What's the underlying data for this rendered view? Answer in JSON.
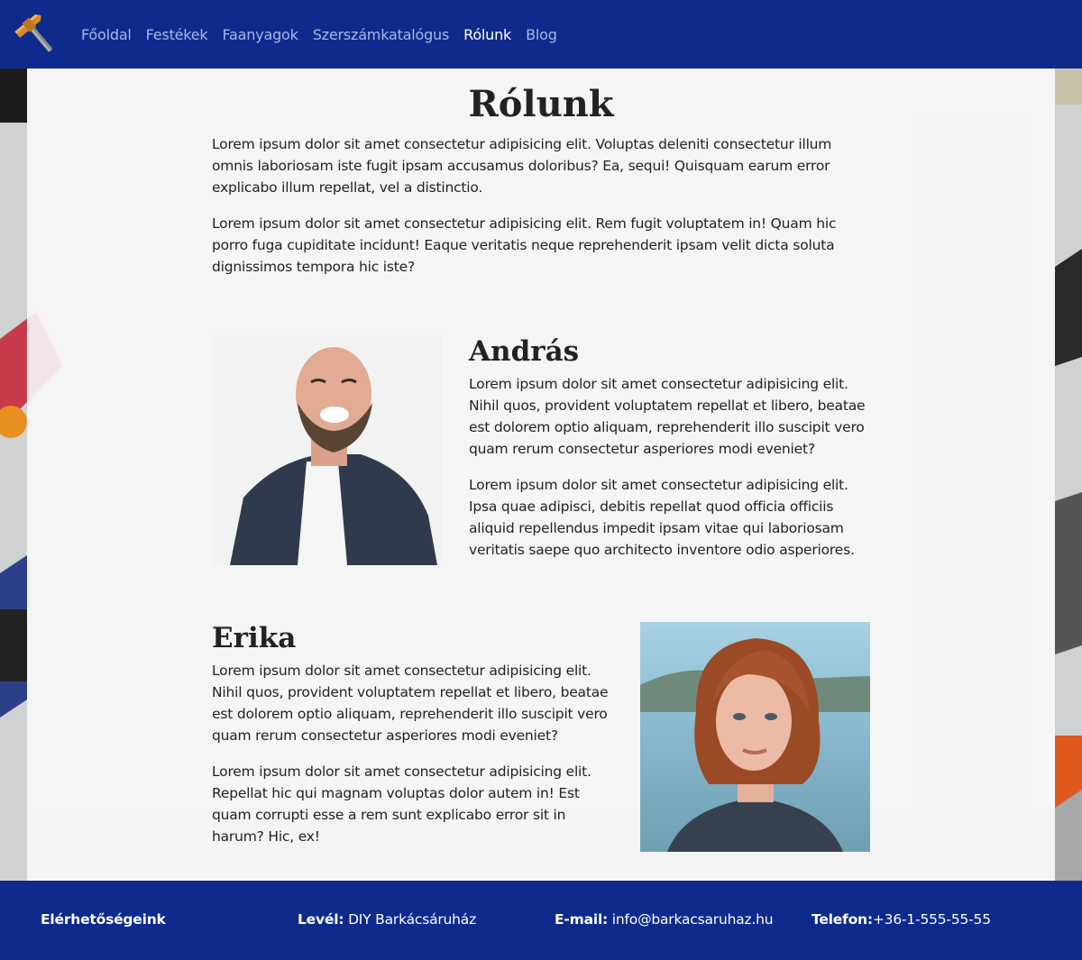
{
  "nav": {
    "logo_icon": "hammer-icon",
    "items": [
      {
        "label": "Főoldal",
        "active": false
      },
      {
        "label": "Festékek",
        "active": false
      },
      {
        "label": "Faanyagok",
        "active": false
      },
      {
        "label": "Szerszámkatalógus",
        "active": false
      },
      {
        "label": "Rólunk",
        "active": true
      },
      {
        "label": "Blog",
        "active": false
      }
    ]
  },
  "colors": {
    "brand": "#0d2a8c",
    "nav_link": "#a9b7e6",
    "nav_active": "#ffffff"
  },
  "page": {
    "title": "Rólunk",
    "intro": [
      "Lorem ipsum dolor sit amet consectetur adipisicing elit. Voluptas deleniti consectetur illum omnis laboriosam iste fugit ipsam accusamus doloribus? Ea, sequi! Quisquam earum error explicabo illum repellat, vel a distinctio.",
      "Lorem ipsum dolor sit amet consectetur adipisicing elit. Rem fugit voluptatem in! Quam hic porro fuga cupiditate incidunt! Eaque veritatis neque reprehenderit ipsam velit dicta soluta dignissimos tempora hic iste?"
    ]
  },
  "people": {
    "andras": {
      "name": "András",
      "paragraphs": [
        "Lorem ipsum dolor sit amet consectetur adipisicing elit. Nihil quos, provident voluptatem repellat et libero, beatae est dolorem optio aliquam, reprehenderit illo suscipit vero quam rerum consectetur asperiores modi eveniet?",
        "Lorem ipsum dolor sit amet consectetur adipisicing elit. Ipsa quae adipisci, debitis repellat quod officia officiis aliquid repellendus impedit ipsam vitae qui laboriosam veritatis saepe quo architecto inventore odio asperiores."
      ]
    },
    "erika": {
      "name": "Erika",
      "paragraphs": [
        "Lorem ipsum dolor sit amet consectetur adipisicing elit. Nihil quos, provident voluptatem repellat et libero, beatae est dolorem optio aliquam, reprehenderit illo suscipit vero quam rerum consectetur asperiores modi eveniet?",
        "Lorem ipsum dolor sit amet consectetur adipisicing elit. Repellat hic qui magnam voluptas dolor autem in! Est quam corrupti esse a rem sunt explicabo error sit in harum? Hic, ex!"
      ]
    }
  },
  "footer": {
    "heading": "Elérhetőségeink",
    "mail_label": "Levél:",
    "mail_value": "DIY Barkácsáruház",
    "email_label": "E-mail:",
    "email_value": "info@barkacsaruhaz.hu",
    "phone_label": "Telefon:",
    "phone_value": "+36-1-555-55-55"
  }
}
